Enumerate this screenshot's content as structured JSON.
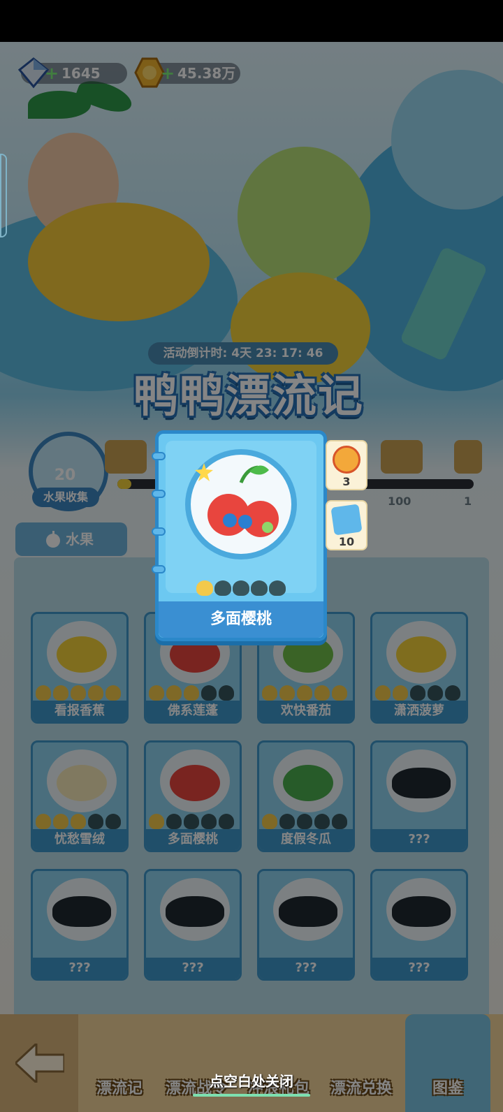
{
  "currency": {
    "gems": "1645",
    "coins": "45.38万"
  },
  "event": {
    "countdown": "活动倒计时: 4天 23: 17: 46",
    "title": "鸭鸭漂流记"
  },
  "progress": {
    "collected": "20",
    "collected_label": "水果收集",
    "fill_fraction": 0.04,
    "milestone_labels": [
      "100",
      "1"
    ]
  },
  "tabs": {
    "fruit_label": "水果"
  },
  "grid": {
    "cards": [
      {
        "name": "看报香蕉",
        "stars": 5,
        "known": true
      },
      {
        "name": "佛系莲蓬",
        "stars": 3,
        "known": true
      },
      {
        "name": "欢快番茄",
        "stars": 5,
        "known": true
      },
      {
        "name": "潇洒菠萝",
        "stars": 2,
        "known": true
      },
      {
        "name": "忧愁雪绒",
        "stars": 3,
        "known": true
      },
      {
        "name": "多面樱桃",
        "stars": 1,
        "known": true
      },
      {
        "name": "度假冬瓜",
        "stars": 1,
        "known": true
      },
      {
        "name": "???",
        "stars": 0,
        "known": false
      },
      {
        "name": "???",
        "stars": 0,
        "known": false
      },
      {
        "name": "???",
        "stars": 0,
        "known": false
      },
      {
        "name": "???",
        "stars": 0,
        "known": false
      },
      {
        "name": "???",
        "stars": 0,
        "known": false
      }
    ]
  },
  "popup": {
    "name": "多面樱桃",
    "stars": 1,
    "max_stars": 5,
    "rewards": [
      {
        "icon": "tomato-icon",
        "count": "3"
      },
      {
        "icon": "ticket-icon",
        "count": "10"
      }
    ]
  },
  "nav": {
    "items": [
      "漂流记",
      "漂流战令",
      "冲浪礼包",
      "漂流兑换",
      "图鉴"
    ],
    "close_hint": "点空白处关闭"
  },
  "colors": {
    "accent_blue": "#3a8fd2",
    "star_gold": "#f3c94b",
    "star_off": "#37555c"
  }
}
